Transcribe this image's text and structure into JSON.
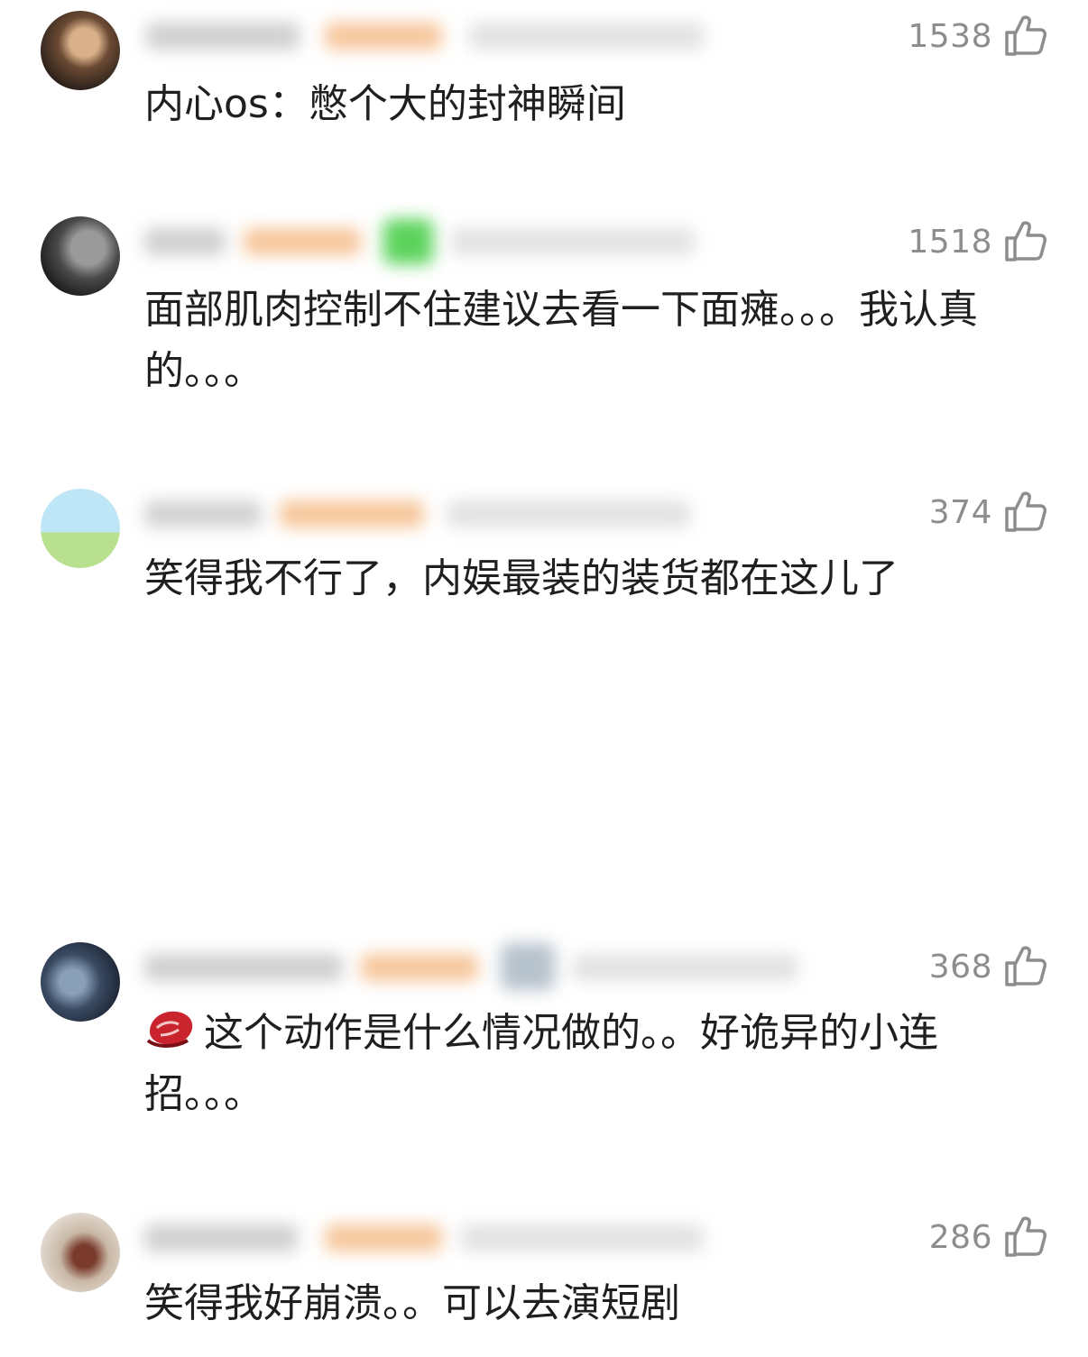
{
  "comments": [
    {
      "likes": "1538",
      "text": "内心os：憋个大的封神瞬间"
    },
    {
      "likes": "1518",
      "text": "面部肌肉控制不住建议去看一下面瘫。。。我认真的。。。"
    },
    {
      "likes": "374",
      "text": "笑得我不行了，内娱最装的装货都在这儿了"
    },
    {
      "likes": "368",
      "text": "这个动作是什么情况做的。。好诡异的小连招。。。"
    },
    {
      "likes": "286",
      "text": "笑得我好崩溃。。可以去演短剧"
    }
  ],
  "icons": {
    "like": "thumbs-up-icon",
    "meat_emoji": "steak-emoji-icon"
  },
  "colors": {
    "text": "#1f1f1f",
    "like_count": "#8d8d8d",
    "badge_orange": "#f6b27a",
    "badge_green": "#5bd35b"
  }
}
